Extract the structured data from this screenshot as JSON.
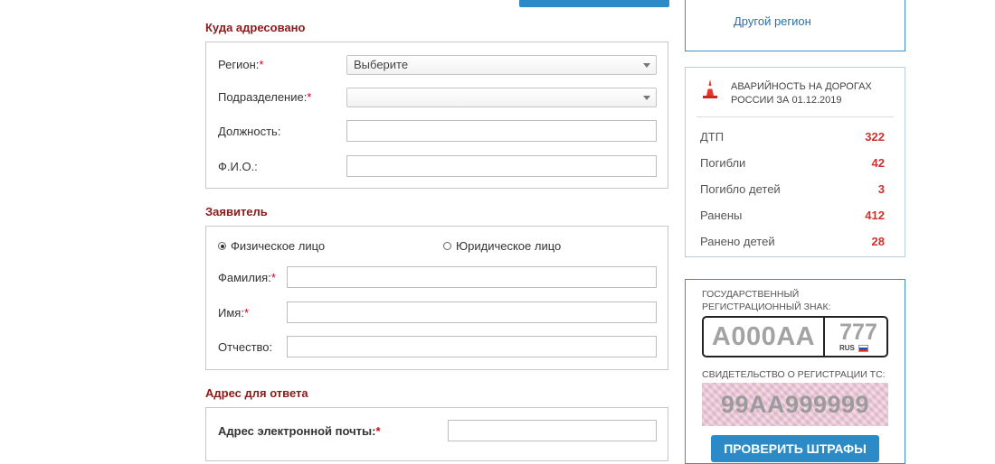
{
  "top_button": {
    "label": ""
  },
  "destination": {
    "title": "Куда адресовано",
    "region": {
      "label": "Регион:",
      "value": "Выберите"
    },
    "division": {
      "label": "Подразделение:",
      "value": ""
    },
    "position": {
      "label": "Должность:",
      "value": ""
    },
    "fio": {
      "label": "Ф.И.О.:",
      "value": ""
    }
  },
  "applicant": {
    "title": "Заявитель",
    "type_individual": "Физическое лицо",
    "type_legal": "Юридическое лицо",
    "selected_type": "individual",
    "surname": {
      "label": "Фамилия:",
      "value": ""
    },
    "name": {
      "label": "Имя:",
      "value": ""
    },
    "patronymic": {
      "label": "Отчество:",
      "value": ""
    }
  },
  "reply_address": {
    "title": "Адрес для ответа",
    "email": {
      "label": "Адрес электронной почты:",
      "value": ""
    }
  },
  "required_mark": "*",
  "sidebar": {
    "other_region_link": "Другой регион",
    "accidents": {
      "title": "Аварийность на дорогах России за 01.12.2019",
      "icon": "traffic-cone-icon",
      "rows": [
        {
          "label": "ДТП",
          "value": "322"
        },
        {
          "label": "Погибли",
          "value": "42"
        },
        {
          "label": "Погибло детей",
          "value": "3"
        },
        {
          "label": "Ранены",
          "value": "412"
        },
        {
          "label": "Ранено детей",
          "value": "28"
        }
      ]
    },
    "fines": {
      "plate_caption": "Государственный регистрационный знак:",
      "plate_number": "А000АА",
      "plate_region": "777",
      "plate_country": "RUS",
      "cert_caption": "Свидетельство о регистрации ТС:",
      "cert_number": "99АА999999",
      "check_button": "Проверить штрафы"
    }
  },
  "colors": {
    "accent_blue": "#2c8bc6",
    "section_title": "#8b1a1a",
    "required": "#d0021b",
    "stat_value": "#d0312d"
  }
}
